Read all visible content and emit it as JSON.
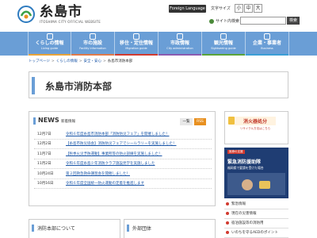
{
  "header": {
    "logo_title": "糸島市",
    "logo_subtitle": "ITOSHIMA CITY OFFICIAL WEBSITE",
    "foreign_language": "Foreign Language",
    "font_size_label": "文字サイズ",
    "font_small": "小",
    "font_medium": "中",
    "font_large": "大",
    "sitemap": "サイト内検索",
    "search_placeholder": "",
    "search_button": "検索"
  },
  "nav": [
    {
      "label": "くらしの情報",
      "en": "Living guide",
      "accent": "#e8a33a"
    },
    {
      "label": "市の施設",
      "en": "Facility information",
      "accent": "#e07a4a"
    },
    {
      "label": "移住・定住情報",
      "en": "Migration guide",
      "accent": "#d23a2f"
    },
    {
      "label": "市政情報",
      "en": "City administration",
      "accent": "#8a5ab0"
    },
    {
      "label": "観光情報",
      "en": "Sightseeing guide",
      "accent": "#5aa33a"
    },
    {
      "label": "企業・事業者",
      "en": "Business",
      "accent": "#3a9ed6"
    }
  ],
  "breadcrumb": [
    "トップページ",
    "くらしの情報",
    "安全・安心",
    "糸島市消防本部"
  ],
  "page_title": "糸島市消防本部",
  "news": {
    "title": "NEWS",
    "subtitle": "新着情報",
    "list_button": "一覧",
    "rss_button": "RSS",
    "items": [
      {
        "date": "12月7日",
        "text": "令和６年度糸島市消防本部「消防防災フェア」を開催しました！"
      },
      {
        "date": "12月2日",
        "text": "【糸島市防災協会】消防防災フェアでシールラリーを実施しました！"
      },
      {
        "date": "11月7日",
        "text": "【秋季火災予防運動】事業所等の防火訓練を実施しました！"
      },
      {
        "date": "11月2日",
        "text": "令和６年度糸島少年消防クラブ施設見学を実施しました"
      },
      {
        "date": "10月24日",
        "text": "第２回救急救命講習会を開催しました！"
      },
      {
        "date": "10月16日",
        "text": "令和６年度全国統一防火運動の定着を推進します"
      }
    ]
  },
  "banners": {
    "banner1_title": "消火器処分",
    "banner1_sub": "リサイクル方法はこちら",
    "banner2_tag": "医療の支援",
    "banner2_title": "緊急消防援助隊",
    "banner2_sub": "福岡県で要請を受けた場合",
    "links": [
      "緊急情報",
      "現在の災害情報",
      "宿泊施設等の消防用",
      "いのちを守るAEDのポイント"
    ]
  },
  "bottom": {
    "left_title": "消防本部について",
    "right_title": "外部団体"
  }
}
